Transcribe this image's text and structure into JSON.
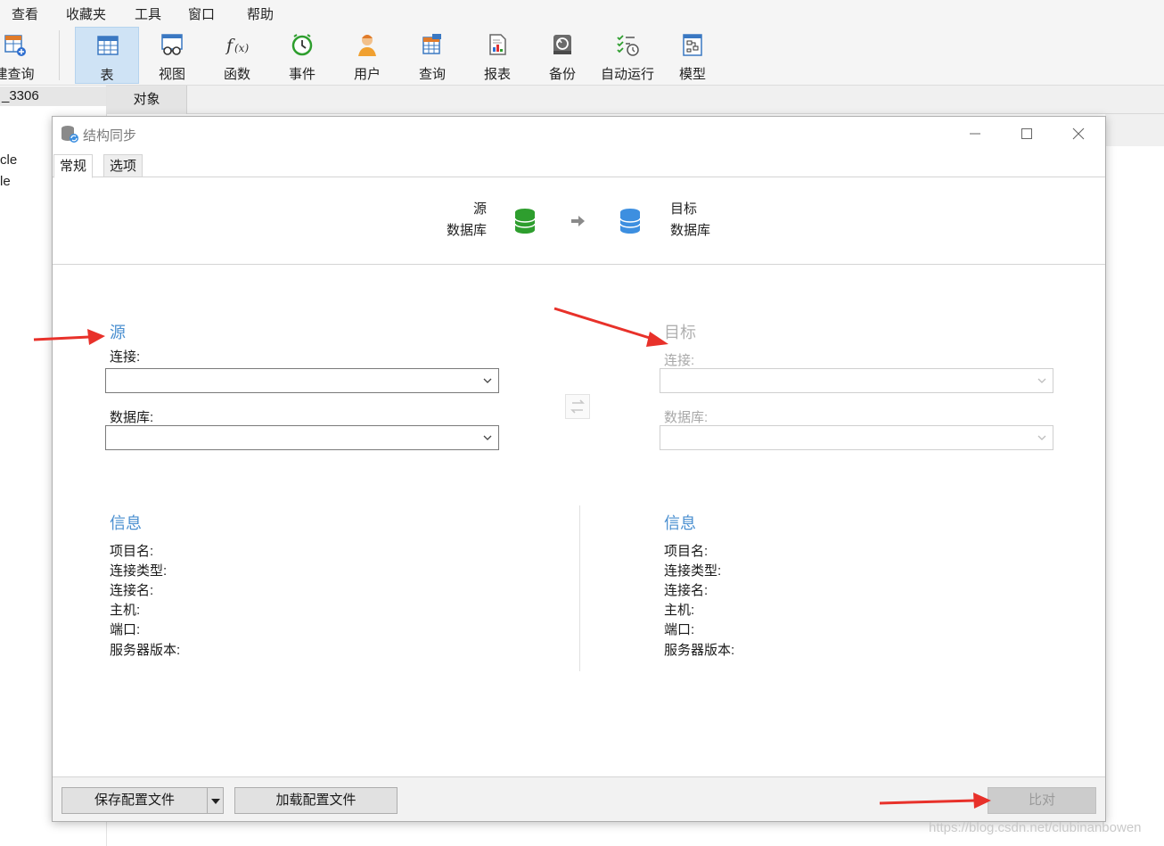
{
  "menubar": {
    "items": [
      "查看",
      "收藏夹",
      "工具",
      "窗口",
      "帮助"
    ]
  },
  "toolbar": {
    "new_query_label": "建查询",
    "tools": [
      {
        "label": "表",
        "icon": "table-icon",
        "active": true
      },
      {
        "label": "视图",
        "icon": "view-icon"
      },
      {
        "label": "函数",
        "icon": "function-icon"
      },
      {
        "label": "事件",
        "icon": "event-clock-icon"
      },
      {
        "label": "用户",
        "icon": "user-icon"
      },
      {
        "label": "查询",
        "icon": "query-icon"
      },
      {
        "label": "报表",
        "icon": "report-icon"
      },
      {
        "label": "备份",
        "icon": "backup-icon"
      },
      {
        "label": "自动运行",
        "icon": "schedule-icon"
      },
      {
        "label": "模型",
        "icon": "model-icon"
      }
    ]
  },
  "left_pane": {
    "connection": "_3306",
    "tree_fragments": [
      "cle",
      "le"
    ]
  },
  "object_tab": {
    "label": "对象"
  },
  "dialog": {
    "title": "结构同步",
    "tabs": {
      "general": "常规",
      "options": "选项"
    },
    "header": {
      "source_line1": "源",
      "source_line2": "数据库",
      "target_line1": "目标",
      "target_line2": "数据库"
    },
    "source": {
      "title": "源",
      "connection_label": "连接:",
      "database_label": "数据库:",
      "connection_value": "",
      "database_value": ""
    },
    "target": {
      "title": "目标",
      "connection_label": "连接:",
      "database_label": "数据库:",
      "connection_value": "",
      "database_value": ""
    },
    "info_left": {
      "title": "信息",
      "lines": [
        "项目名:",
        "连接类型:",
        "连接名:",
        "主机:",
        "端口:",
        "服务器版本:"
      ]
    },
    "info_right": {
      "title": "信息",
      "lines": [
        "项目名:",
        "连接类型:",
        "连接名:",
        "主机:",
        "端口:",
        "服务器版本:"
      ]
    },
    "buttons": {
      "save_profile": "保存配置文件",
      "load_profile": "加载配置文件",
      "compare": "比对"
    }
  },
  "colors": {
    "accent": "#4a8fd0",
    "source_db": "#2e9e2e",
    "target_db": "#3d8fe0",
    "annotation_arrow": "#e8312a"
  },
  "watermark": "https://blog.csdn.net/clubinanbowen"
}
